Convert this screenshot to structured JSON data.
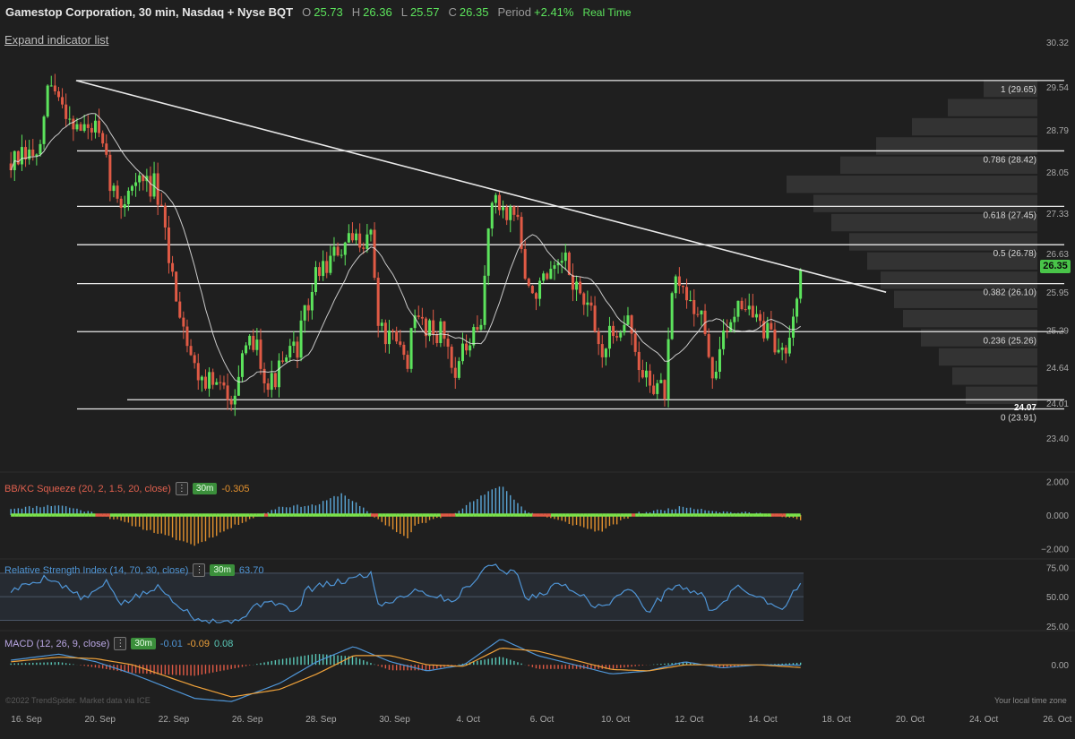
{
  "header": {
    "title": "Gamestop Corporation, 30 min, Nasdaq + Nyse BQT",
    "open_label": "O",
    "open": "25.73",
    "high_label": "H",
    "high": "26.36",
    "low_label": "L",
    "low": "25.57",
    "close_label": "C",
    "close": "26.35",
    "period_label": "Period",
    "period": "+2.41%",
    "realtime": "Real Time"
  },
  "expand_label": "Expand indicator list",
  "last_price": "26.35",
  "copyright": "©2022 TrendSpider. Market data via ICE",
  "timezone": "Your local time zone",
  "indicators": {
    "squeeze": {
      "label": "BB/KC Squeeze (20, 2, 1.5, 20, close)",
      "menu": "⋮",
      "tf": "30m",
      "value": "-0.305"
    },
    "rsi": {
      "label": "Relative Strength Index (14, 70, 30, close)",
      "menu": "⋮",
      "tf": "30m",
      "value": "63.70"
    },
    "macd": {
      "label": "MACD (12, 26, 9, close)",
      "menu": "⋮",
      "tf": "30m",
      "v1": "-0.01",
      "v2": "-0.09",
      "v3": "0.08"
    }
  },
  "colors": {
    "bg": "#1f1f1f",
    "up": "#5ce35c",
    "down": "#e05a45",
    "text": "#cfcfcf",
    "squeeze_pos": "#5aa6d6",
    "squeeze_neg": "#e3912e",
    "rsi_line": "#4f95d6",
    "macd_line": "#4f95d6",
    "signal_line": "#f0a23a",
    "fib_line": "#e8e8e8"
  },
  "chart_data": [
    {
      "type": "candlestick",
      "title": "Gamestop Corporation, 30 min, Nasdaq + Nyse BQT",
      "x_ticks": [
        "16. Sep",
        "20. Sep",
        "22. Sep",
        "26. Sep",
        "28. Sep",
        "30. Sep",
        "4. Oct",
        "6. Oct",
        "10. Oct",
        "12. Oct",
        "14. Oct",
        "18. Oct",
        "20. Oct",
        "24. Oct",
        "26. Oct"
      ],
      "y_ticks": [
        30.32,
        29.54,
        28.79,
        28.05,
        27.33,
        26.63,
        25.95,
        25.29,
        24.64,
        24.01,
        23.4
      ],
      "ylim": [
        23.15,
        30.4
      ],
      "last_price": 26.35,
      "fib_levels": [
        {
          "label": "1 (29.65)",
          "value": 29.65
        },
        {
          "label": "0.786 (28.42)",
          "value": 28.42
        },
        {
          "label": "0.618 (27.45)",
          "value": 27.45
        },
        {
          "label": "0.5 (26.78)",
          "value": 26.78
        },
        {
          "label": "0.382 (26.10)",
          "value": 26.1
        },
        {
          "label": "0.236 (25.26)",
          "value": 25.26
        },
        {
          "label": "0 (23.91)",
          "value": 23.91
        }
      ],
      "support_label": "24.07",
      "support_value": 24.07,
      "trendline": {
        "from": {
          "date": "2022-09-19 15:00",
          "price": 29.65
        },
        "to": {
          "date": "2022-10-19 15:00",
          "price": 25.95
        }
      },
      "price_path": [
        {
          "date": "2022-09-16 10:00",
          "price": 28.2
        },
        {
          "date": "2022-09-16 15:30",
          "price": 28.4
        },
        {
          "date": "2022-09-19 10:00",
          "price": 29.6
        },
        {
          "date": "2022-09-19 15:30",
          "price": 28.8
        },
        {
          "date": "2022-09-20 12:00",
          "price": 28.8
        },
        {
          "date": "2022-09-20 16:00",
          "price": 27.4
        },
        {
          "date": "2022-09-21 12:00",
          "price": 27.9
        },
        {
          "date": "2022-09-21 16:00",
          "price": 27.8
        },
        {
          "date": "2022-09-22 13:00",
          "price": 26.0
        },
        {
          "date": "2022-09-23 10:00",
          "price": 24.6
        },
        {
          "date": "2022-09-23 15:00",
          "price": 24.2
        },
        {
          "date": "2022-09-26 10:00",
          "price": 24.2
        },
        {
          "date": "2022-09-26 14:00",
          "price": 25.2
        },
        {
          "date": "2022-09-27 10:00",
          "price": 24.3
        },
        {
          "date": "2022-09-27 15:00",
          "price": 25.0
        },
        {
          "date": "2022-09-28 12:00",
          "price": 26.3
        },
        {
          "date": "2022-09-29 10:00",
          "price": 26.7
        },
        {
          "date": "2022-09-29 15:00",
          "price": 27.0
        },
        {
          "date": "2022-09-30 10:00",
          "price": 25.3
        },
        {
          "date": "2022-09-30 15:00",
          "price": 24.8
        },
        {
          "date": "2022-10-03 10:00",
          "price": 25.5
        },
        {
          "date": "2022-10-03 15:00",
          "price": 25.2
        },
        {
          "date": "2022-10-04 10:00",
          "price": 24.6
        },
        {
          "date": "2022-10-04 15:00",
          "price": 25.3
        },
        {
          "date": "2022-10-05 10:00",
          "price": 27.5
        },
        {
          "date": "2022-10-05 15:00",
          "price": 27.3
        },
        {
          "date": "2022-10-06 10:00",
          "price": 25.9
        },
        {
          "date": "2022-10-06 15:00",
          "price": 26.2
        },
        {
          "date": "2022-10-07 10:00",
          "price": 26.5
        },
        {
          "date": "2022-10-07 15:00",
          "price": 25.5
        },
        {
          "date": "2022-10-10 10:00",
          "price": 24.9
        },
        {
          "date": "2022-10-10 15:00",
          "price": 25.6
        },
        {
          "date": "2022-10-11 10:00",
          "price": 24.6
        },
        {
          "date": "2022-10-11 15:00",
          "price": 24.2
        },
        {
          "date": "2022-10-12 10:00",
          "price": 26.1
        },
        {
          "date": "2022-10-12 15:00",
          "price": 25.6
        },
        {
          "date": "2022-10-13 10:00",
          "price": 24.4
        },
        {
          "date": "2022-10-13 15:00",
          "price": 25.9
        },
        {
          "date": "2022-10-14 10:00",
          "price": 25.7
        },
        {
          "date": "2022-10-14 15:00",
          "price": 25.0
        },
        {
          "date": "2022-10-17 10:00",
          "price": 24.9
        },
        {
          "date": "2022-10-17 13:00",
          "price": 26.35
        }
      ]
    },
    {
      "type": "bar",
      "title": "BB/KC Squeeze (20, 2, 1.5, 20, close)",
      "y_ticks": [
        2.0,
        0.0,
        -2.0
      ],
      "y_tick_labels": [
        "2.000",
        "0.000",
        "−2.000"
      ],
      "ylim": [
        -2.4,
        2.4
      ],
      "last_value": -0.305,
      "momentum_path": [
        {
          "date": "2022-09-16 10:00",
          "value": 0.4
        },
        {
          "date": "2022-09-19 12:00",
          "value": 0.6
        },
        {
          "date": "2022-09-20 12:00",
          "value": 0.1
        },
        {
          "date": "2022-09-21 12:00",
          "value": -0.6
        },
        {
          "date": "2022-09-23 10:00",
          "value": -1.8
        },
        {
          "date": "2022-09-26 12:00",
          "value": -0.4
        },
        {
          "date": "2022-09-27 12:00",
          "value": 0.5
        },
        {
          "date": "2022-09-28 12:00",
          "value": 0.6
        },
        {
          "date": "2022-09-29 10:00",
          "value": 1.3
        },
        {
          "date": "2022-09-30 10:00",
          "value": -0.3
        },
        {
          "date": "2022-09-30 15:00",
          "value": -1.4
        },
        {
          "date": "2022-10-03 10:00",
          "value": -0.6
        },
        {
          "date": "2022-10-04 10:00",
          "value": 0.1
        },
        {
          "date": "2022-10-05 12:00",
          "value": 1.8
        },
        {
          "date": "2022-10-06 10:00",
          "value": 0.2
        },
        {
          "date": "2022-10-07 10:00",
          "value": -0.4
        },
        {
          "date": "2022-10-10 10:00",
          "value": -1.0
        },
        {
          "date": "2022-10-11 10:00",
          "value": 0.1
        },
        {
          "date": "2022-10-12 12:00",
          "value": 0.5
        },
        {
          "date": "2022-10-13 12:00",
          "value": 0.2
        },
        {
          "date": "2022-10-14 12:00",
          "value": 0.1
        },
        {
          "date": "2022-10-17 13:00",
          "value": -0.3
        }
      ]
    },
    {
      "type": "line",
      "title": "Relative Strength Index (14, 70, 30, close)",
      "y_ticks": [
        75,
        50,
        25
      ],
      "y_tick_labels": [
        "75.00",
        "50.00",
        "25.00"
      ],
      "ylim": [
        22,
        79
      ],
      "band": [
        30,
        70
      ],
      "last_value": 63.7,
      "series": [
        {
          "points": [
            {
              "date": "2022-09-16 10:00",
              "value": 55
            },
            {
              "date": "2022-09-19 10:00",
              "value": 67
            },
            {
              "date": "2022-09-20 10:00",
              "value": 48
            },
            {
              "date": "2022-09-20 14:00",
              "value": 62
            },
            {
              "date": "2022-09-21 10:00",
              "value": 44
            },
            {
              "date": "2022-09-22 10:00",
              "value": 58
            },
            {
              "date": "2022-09-23 10:00",
              "value": 32
            },
            {
              "date": "2022-09-26 10:00",
              "value": 28
            },
            {
              "date": "2022-09-27 10:00",
              "value": 48
            },
            {
              "date": "2022-09-27 15:00",
              "value": 36
            },
            {
              "date": "2022-09-28 10:00",
              "value": 56
            },
            {
              "date": "2022-09-29 10:00",
              "value": 63
            },
            {
              "date": "2022-09-29 15:00",
              "value": 70
            },
            {
              "date": "2022-09-30 10:00",
              "value": 42
            },
            {
              "date": "2022-10-03 10:00",
              "value": 56
            },
            {
              "date": "2022-10-04 10:00",
              "value": 46
            },
            {
              "date": "2022-10-05 10:00",
              "value": 78
            },
            {
              "date": "2022-10-05 15:00",
              "value": 68
            },
            {
              "date": "2022-10-06 10:00",
              "value": 47
            },
            {
              "date": "2022-10-07 10:00",
              "value": 62
            },
            {
              "date": "2022-10-10 10:00",
              "value": 40
            },
            {
              "date": "2022-10-10 15:00",
              "value": 57
            },
            {
              "date": "2022-10-11 12:00",
              "value": 38
            },
            {
              "date": "2022-10-12 10:00",
              "value": 60
            },
            {
              "date": "2022-10-12 15:00",
              "value": 52
            },
            {
              "date": "2022-10-13 10:00",
              "value": 37
            },
            {
              "date": "2022-10-13 15:00",
              "value": 58
            },
            {
              "date": "2022-10-14 10:00",
              "value": 55
            },
            {
              "date": "2022-10-14 15:00",
              "value": 42
            },
            {
              "date": "2022-10-17 10:00",
              "value": 41
            },
            {
              "date": "2022-10-17 13:00",
              "value": 63.7
            }
          ]
        }
      ]
    },
    {
      "type": "line",
      "title": "MACD (12, 26, 9, close)",
      "y_ticks": [
        0.0
      ],
      "y_tick_labels": [
        "0.00"
      ],
      "ylim": [
        -1.4,
        1.0
      ],
      "last_values": {
        "macd": -0.01,
        "signal": -0.09,
        "histogram": 0.08
      },
      "series": [
        {
          "points": [
            {
              "date": "2022-09-16 10:00",
              "value": 0.15
            },
            {
              "date": "2022-09-19 12:00",
              "value": 0.35
            },
            {
              "date": "2022-09-20 12:00",
              "value": 0.1
            },
            {
              "date": "2022-09-21 12:00",
              "value": -0.3
            },
            {
              "date": "2022-09-23 10:00",
              "value": -1.1
            },
            {
              "date": "2022-09-26 10:00",
              "value": -1.2
            },
            {
              "date": "2022-09-27 12:00",
              "value": -0.6
            },
            {
              "date": "2022-09-28 12:00",
              "value": 0.1
            },
            {
              "date": "2022-09-29 12:00",
              "value": 0.6
            },
            {
              "date": "2022-09-30 12:00",
              "value": 0.1
            },
            {
              "date": "2022-10-03 12:00",
              "value": -0.2
            },
            {
              "date": "2022-10-04 12:00",
              "value": 0.0
            },
            {
              "date": "2022-10-05 12:00",
              "value": 0.85
            },
            {
              "date": "2022-10-06 12:00",
              "value": 0.3
            },
            {
              "date": "2022-10-07 12:00",
              "value": 0.0
            },
            {
              "date": "2022-10-10 12:00",
              "value": -0.3
            },
            {
              "date": "2022-10-11 12:00",
              "value": -0.2
            },
            {
              "date": "2022-10-12 12:00",
              "value": 0.1
            },
            {
              "date": "2022-10-13 12:00",
              "value": -0.1
            },
            {
              "date": "2022-10-14 12:00",
              "value": 0.0
            },
            {
              "date": "2022-10-17 13:00",
              "value": -0.01
            }
          ]
        },
        {
          "points": [
            {
              "date": "2022-09-16 10:00",
              "value": 0.1
            },
            {
              "date": "2022-09-19 12:00",
              "value": 0.25
            },
            {
              "date": "2022-09-20 12:00",
              "value": 0.2
            },
            {
              "date": "2022-09-21 12:00",
              "value": 0.0
            },
            {
              "date": "2022-09-23 10:00",
              "value": -0.7
            },
            {
              "date": "2022-09-26 10:00",
              "value": -1.05
            },
            {
              "date": "2022-09-27 12:00",
              "value": -0.8
            },
            {
              "date": "2022-09-28 12:00",
              "value": -0.3
            },
            {
              "date": "2022-09-29 12:00",
              "value": 0.3
            },
            {
              "date": "2022-09-30 12:00",
              "value": 0.3
            },
            {
              "date": "2022-10-03 12:00",
              "value": 0.0
            },
            {
              "date": "2022-10-04 12:00",
              "value": -0.05
            },
            {
              "date": "2022-10-05 12:00",
              "value": 0.55
            },
            {
              "date": "2022-10-06 12:00",
              "value": 0.45
            },
            {
              "date": "2022-10-07 12:00",
              "value": 0.15
            },
            {
              "date": "2022-10-10 12:00",
              "value": -0.15
            },
            {
              "date": "2022-10-11 12:00",
              "value": -0.2
            },
            {
              "date": "2022-10-12 12:00",
              "value": 0.0
            },
            {
              "date": "2022-10-13 12:00",
              "value": 0.0
            },
            {
              "date": "2022-10-14 12:00",
              "value": 0.0
            },
            {
              "date": "2022-10-17 13:00",
              "value": -0.09
            }
          ]
        }
      ]
    }
  ]
}
